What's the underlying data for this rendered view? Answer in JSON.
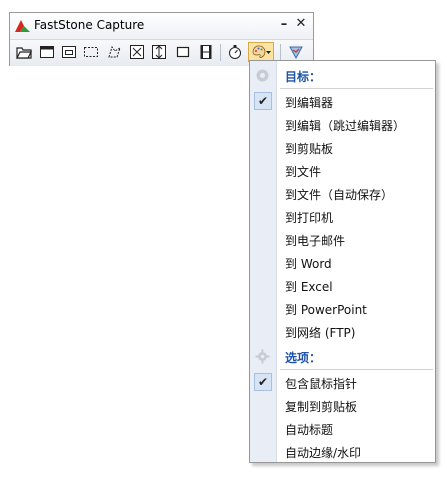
{
  "window": {
    "title": "FastStone Capture",
    "minimize_glyph": "–",
    "close_glyph": "✕"
  },
  "toolbar": {
    "buttons": [
      {
        "name": "open-file-icon"
      },
      {
        "name": "capture-window-icon"
      },
      {
        "name": "capture-object-icon"
      },
      {
        "name": "capture-rectangle-icon"
      },
      {
        "name": "capture-freehand-icon"
      },
      {
        "name": "capture-fullscreen-icon"
      },
      {
        "name": "capture-scrolling-icon"
      },
      {
        "name": "capture-fixed-region-icon"
      },
      {
        "name": "screen-recorder-icon"
      },
      {
        "name": "delay-timer-icon"
      },
      {
        "name": "output-destination-icon"
      },
      {
        "name": "settings-icon"
      }
    ]
  },
  "menu": {
    "target_header": "目标：",
    "target_items": [
      {
        "label": "到编辑器",
        "checked": true
      },
      {
        "label": "到编辑（跳过编辑器）",
        "checked": false
      },
      {
        "label": "到剪贴板",
        "checked": false
      },
      {
        "label": "到文件",
        "checked": false
      },
      {
        "label": "到文件（自动保存）",
        "checked": false
      },
      {
        "label": "到打印机",
        "checked": false
      },
      {
        "label": "到电子邮件",
        "checked": false
      },
      {
        "label": "到 Word",
        "checked": false
      },
      {
        "label": "到 Excel",
        "checked": false
      },
      {
        "label": "到 PowerPoint",
        "checked": false
      },
      {
        "label": "到网络 (FTP)",
        "checked": false
      }
    ],
    "options_header": "选项：",
    "option_items": [
      {
        "label": "包含鼠标指针",
        "checked": true
      },
      {
        "label": "复制到剪贴板",
        "checked": false
      },
      {
        "label": "自动标题",
        "checked": false
      },
      {
        "label": "自动边缘/水印",
        "checked": false
      }
    ],
    "check_glyph": "✔"
  },
  "colors": {
    "header_text": "#1f53a8",
    "gutter": "#e9eef6",
    "check_bg": "#d6e4f5",
    "active_button": "#fbe3a4"
  }
}
